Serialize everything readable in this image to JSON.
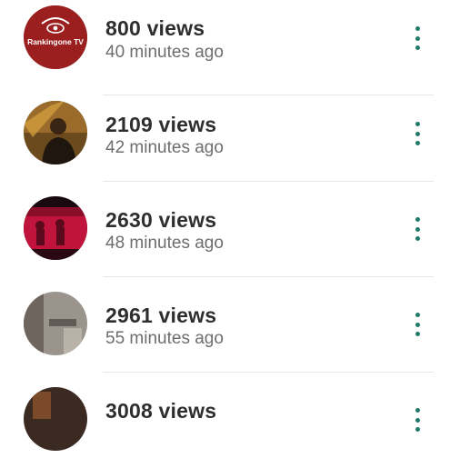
{
  "status_list": {
    "accent_color": "#1f7a6a",
    "items": [
      {
        "views": "800 views",
        "time": "40 minutes ago",
        "thumbnail": "rankingone-tv-logo",
        "thumbnail_text": "Rankingone TV",
        "menu_icon": "more-vert-icon"
      },
      {
        "views": "2109 views",
        "time": "42 minutes ago",
        "thumbnail": "person-photo",
        "menu_icon": "more-vert-icon"
      },
      {
        "views": "2630 views",
        "time": "48 minutes ago",
        "thumbnail": "red-stage-photo",
        "menu_icon": "more-vert-icon"
      },
      {
        "views": "2961 views",
        "time": "55 minutes ago",
        "thumbnail": "grey-scene-photo",
        "menu_icon": "more-vert-icon"
      },
      {
        "views": "3008 views",
        "time": "",
        "thumbnail": "dark-photo",
        "menu_icon": "more-vert-icon"
      }
    ]
  }
}
